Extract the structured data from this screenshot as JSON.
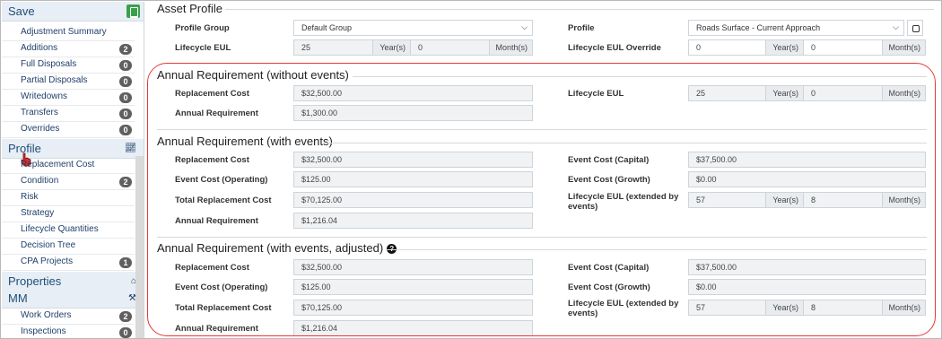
{
  "sidebar": {
    "save": "Save",
    "items_top": [
      {
        "label": "Adjustment Summary",
        "badge": ""
      },
      {
        "label": "Additions",
        "badge": "2"
      },
      {
        "label": "Full Disposals",
        "badge": "0"
      },
      {
        "label": "Partial Disposals",
        "badge": "0"
      },
      {
        "label": "Writedowns",
        "badge": "0"
      },
      {
        "label": "Transfers",
        "badge": "0"
      },
      {
        "label": "Overrides",
        "badge": "0"
      }
    ],
    "profile": "Profile",
    "items_profile": [
      {
        "label": "Replacement Cost",
        "badge": ""
      },
      {
        "label": "Condition",
        "badge": "2"
      },
      {
        "label": "Risk",
        "badge": ""
      },
      {
        "label": "Strategy",
        "badge": ""
      },
      {
        "label": "Lifecycle Quantities",
        "badge": ""
      },
      {
        "label": "Decision Tree",
        "badge": ""
      },
      {
        "label": "CPA Projects",
        "badge": "1"
      }
    ],
    "properties": "Properties",
    "mm": "MM",
    "items_mm": [
      {
        "label": "Work Orders",
        "badge": "2"
      },
      {
        "label": "Inspections",
        "badge": "0"
      }
    ]
  },
  "asset_profile": {
    "title": "Asset Profile",
    "profile_group_label": "Profile Group",
    "profile_group_value": "Default Group",
    "profile_label": "Profile",
    "profile_value": "Roads Surface - Current Approach",
    "eul_label": "Lifecycle EUL",
    "eul_years": "25",
    "eul_months": "0",
    "eul_override_label": "Lifecycle EUL Override",
    "eul_override_years": "0",
    "eul_override_months": "0",
    "years_unit": "Year(s)",
    "months_unit": "Month(s)"
  },
  "without_events": {
    "title": "Annual Requirement (without events)",
    "replacement_cost_label": "Replacement Cost",
    "replacement_cost": "$32,500.00",
    "annual_req_label": "Annual Requirement",
    "annual_req": "$1,300.00",
    "eul_label": "Lifecycle EUL",
    "eul_years": "25",
    "eul_months": "0"
  },
  "with_events": {
    "title": "Annual Requirement (with events)",
    "replacement_cost_label": "Replacement Cost",
    "replacement_cost": "$32,500.00",
    "event_cost_op_label": "Event Cost (Operating)",
    "event_cost_op": "$125.00",
    "total_replacement_label": "Total Replacement Cost",
    "total_replacement": "$70,125.00",
    "annual_req_label": "Annual Requirement",
    "annual_req": "$1,216.04",
    "event_cost_cap_label": "Event Cost (Capital)",
    "event_cost_cap": "$37,500.00",
    "event_cost_growth_label": "Event Cost (Growth)",
    "event_cost_growth": "$0.00",
    "eul_ext_label_1": "Lifecycle EUL (extended by",
    "eul_ext_label_2": "events)",
    "eul_ext_years": "57",
    "eul_ext_months": "8"
  },
  "adjusted": {
    "title": "Annual Requirement (with events, adjusted)",
    "replacement_cost_label": "Replacement Cost",
    "replacement_cost": "$32,500.00",
    "event_cost_op_label": "Event Cost (Operating)",
    "event_cost_op": "$125.00",
    "total_replacement_label": "Total Replacement Cost",
    "total_replacement": "$70,125.00",
    "annual_req_label": "Annual Requirement",
    "annual_req": "$1,216.04",
    "event_cost_cap_label": "Event Cost (Capital)",
    "event_cost_cap": "$37,500.00",
    "event_cost_growth_label": "Event Cost (Growth)",
    "event_cost_growth": "$0.00",
    "eul_ext_label_1": "Lifecycle EUL (extended by",
    "eul_ext_label_2": "events)",
    "eul_ext_years": "57",
    "eul_ext_months": "8"
  },
  "colors": {
    "accent": "#1f4e79",
    "highlight": "#e53935",
    "save_green": "#3aa14b"
  }
}
